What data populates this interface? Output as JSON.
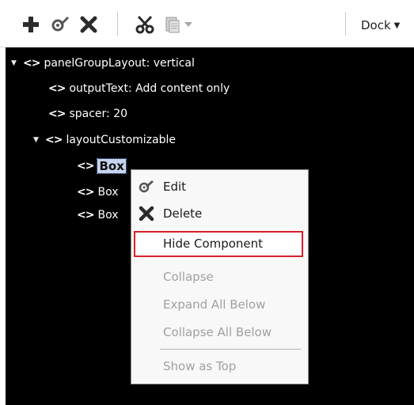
{
  "toolbar": {
    "icons": [
      "add-icon",
      "edit-icon",
      "delete-icon",
      "cut-icon",
      "paste-icon",
      "dropdown-arrow-icon"
    ],
    "dock_label": "Dock"
  },
  "tree": {
    "root": {
      "label": "panelGroupLayout: vertical",
      "expanded": true
    },
    "items": [
      {
        "label": "outputText: Add content only"
      },
      {
        "label": "spacer: 20"
      },
      {
        "label": "layoutCustomizable",
        "expanded": true
      },
      {
        "label": "Box",
        "selected": true
      },
      {
        "label": "Box"
      },
      {
        "label": "Box"
      }
    ]
  },
  "context_menu": {
    "items": [
      {
        "label": "Edit",
        "icon": "edit-icon",
        "enabled": true
      },
      {
        "label": "Delete",
        "icon": "delete-icon",
        "enabled": true
      },
      {
        "label": "Hide Component",
        "enabled": true,
        "highlighted": true
      },
      {
        "label": "Collapse",
        "enabled": false
      },
      {
        "label": "Expand All Below",
        "enabled": false
      },
      {
        "label": "Collapse All Below",
        "enabled": false
      },
      {
        "label": "Show as Top",
        "enabled": false
      }
    ],
    "highlight_color": "#d8202a"
  },
  "colors": {
    "panel_background": "#000000",
    "menu_background": "#f8f8f8",
    "disabled_text": "#a0a0a0"
  }
}
